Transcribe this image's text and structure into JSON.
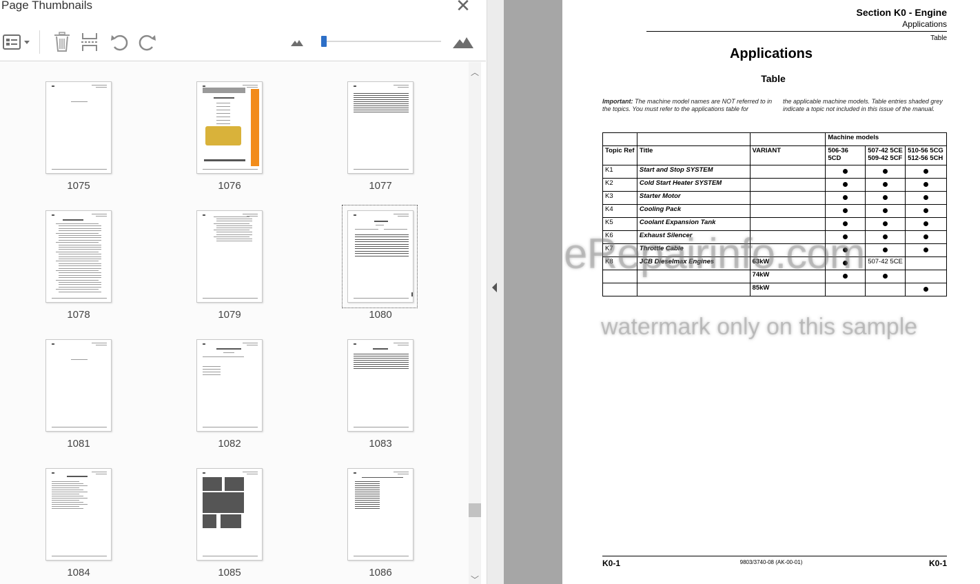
{
  "panel": {
    "title": "Page Thumbnails",
    "close_label": "✕",
    "toolbar": {
      "options_icon": "thumbnail-options-icon",
      "delete_icon": "trash-icon",
      "extract_icon": "extract-pages-icon",
      "rotate_ccw_icon": "rotate-counterclockwise-icon",
      "rotate_cw_icon": "rotate-clockwise-icon",
      "zoom_out_icon": "small-mountain-icon",
      "zoom_in_icon": "large-mountain-icon",
      "zoom_level": 0.0
    },
    "selected_page": "1080",
    "thumbnails": [
      {
        "page": "1075",
        "kind": "blank-toc"
      },
      {
        "page": "1076",
        "kind": "section-cover"
      },
      {
        "page": "1077",
        "kind": "lines"
      },
      {
        "page": "1078",
        "kind": "toc-long"
      },
      {
        "page": "1079",
        "kind": "toc-short"
      },
      {
        "page": "1080",
        "kind": "table"
      },
      {
        "page": "1081",
        "kind": "blank-toc"
      },
      {
        "page": "1082",
        "kind": "links"
      },
      {
        "page": "1083",
        "kind": "small-table"
      },
      {
        "page": "1084",
        "kind": "text"
      },
      {
        "page": "1085",
        "kind": "images"
      },
      {
        "page": "1086",
        "kind": "list-table"
      }
    ]
  },
  "document": {
    "header": {
      "section": "Section K0 - Engine",
      "subsection": "Applications",
      "tag": "Table"
    },
    "heading": "Applications",
    "subheading": "Table",
    "note_left_label": "Important:",
    "note_left": " The machine model names are NOT referred to in the topics. You must refer to the applications table for",
    "note_right": "the applicable machine models. Table entries shaded grey indicate a topic not included in this issue of the manual.",
    "table": {
      "group_header": "Machine models",
      "col_topic": "Topic Ref",
      "col_title": "Title",
      "col_variant": "VARIANT",
      "col_m1": "506-36 5CD",
      "col_m2a": "507-42 5CE",
      "col_m2b": "509-42 5CF",
      "col_m3a": "510-56 5CG",
      "col_m3b": "512-56 5CH",
      "rows": [
        {
          "ref": "K1",
          "title": "Start and Stop SYSTEM",
          "variant": "",
          "m1": true,
          "m2": true,
          "m3": true
        },
        {
          "ref": "K2",
          "title": "Cold Start Heater SYSTEM",
          "variant": "",
          "m1": true,
          "m2": true,
          "m3": true
        },
        {
          "ref": "K3",
          "title": "Starter Motor",
          "variant": "",
          "m1": true,
          "m2": true,
          "m3": true
        },
        {
          "ref": "K4",
          "title": "Cooling Pack",
          "variant": "",
          "m1": true,
          "m2": true,
          "m3": true
        },
        {
          "ref": "K5",
          "title": "Coolant Expansion Tank",
          "variant": "",
          "m1": true,
          "m2": true,
          "m3": true
        },
        {
          "ref": "K6",
          "title": "Exhaust Silencer",
          "variant": "",
          "m1": true,
          "m2": true,
          "m3": true
        },
        {
          "ref": "K7",
          "title": "Throttle Cable",
          "variant": "",
          "m1": true,
          "m2": true,
          "m3": true
        },
        {
          "ref": "K8",
          "title": "JCB Dieselmax Engines",
          "variant": "63kW",
          "m1": true,
          "m2_text": "507-42 5CE",
          "m3": false
        },
        {
          "ref": "",
          "title": "",
          "variant": "74kW",
          "m1": true,
          "m2": true,
          "m3": false
        },
        {
          "ref": "",
          "title": "",
          "variant": "85kW",
          "m1": false,
          "m2": false,
          "m3": true
        }
      ]
    },
    "watermark_main": "eRepairinfo.com",
    "watermark_sub": "watermark only on this sample",
    "footer": {
      "left": "K0-1",
      "center": "9803/3740-08 (AK-00-01)",
      "right": "K0-1"
    }
  }
}
